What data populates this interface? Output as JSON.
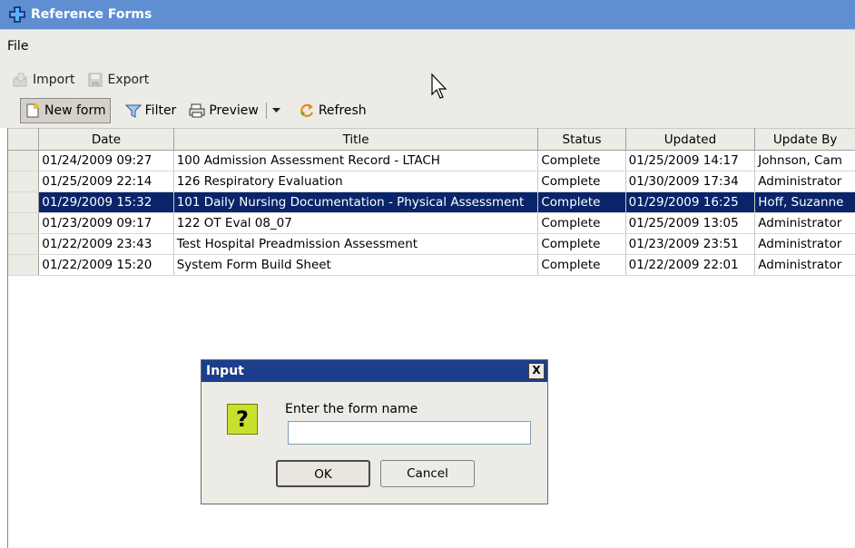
{
  "window": {
    "title": "Reference Forms"
  },
  "menu": {
    "file": "File"
  },
  "toolbar": {
    "import": "Import",
    "export": "Export",
    "new_form": "New form",
    "filter": "Filter",
    "preview": "Preview",
    "refresh": "Refresh"
  },
  "table": {
    "columns": [
      "Date",
      "Title",
      "Status",
      "Updated",
      "Update By"
    ],
    "rows": [
      [
        "01/24/2009 09:27",
        "100 Admission Assessment Record - LTACH",
        "Complete",
        "01/25/2009 14:17",
        "Johnson, Cam"
      ],
      [
        "01/25/2009 22:14",
        "126 Respiratory Evaluation",
        "Complete",
        "01/30/2009 17:34",
        "Administrator"
      ],
      [
        "01/29/2009 15:32",
        "101 Daily Nursing Documentation - Physical Assessment",
        "Complete",
        "01/29/2009 16:25",
        "Hoff, Suzanne"
      ],
      [
        "01/23/2009 09:17",
        "122 OT Eval 08_07",
        "Complete",
        "01/25/2009 13:05",
        "Administrator"
      ],
      [
        "01/22/2009 23:43",
        "Test Hospital Preadmission Assessment",
        "Complete",
        "01/23/2009 23:51",
        "Administrator"
      ],
      [
        "01/22/2009 15:20",
        "System Form Build Sheet",
        "Complete",
        "01/22/2009 22:01",
        "Administrator"
      ]
    ],
    "selected_row": 2
  },
  "dialog": {
    "title": "Input",
    "close": "X",
    "icon_glyph": "?",
    "prompt": "Enter the form name",
    "input_value": "",
    "ok": "OK",
    "cancel": "Cancel"
  },
  "colors": {
    "titlebar": "#5f8fd1",
    "selection": "#0a246a",
    "dialog_title": "#1c3e8c",
    "question_icon": "#c9e02c"
  }
}
